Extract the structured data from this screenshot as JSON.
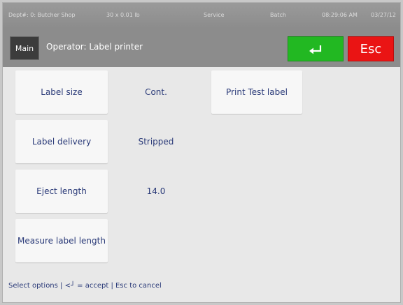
{
  "status": {
    "dept": "Dept#: 0: Butcher Shop",
    "scale": "30 x 0.01 lb",
    "service": "Service",
    "batch": "Batch",
    "time": "08:29:06 AM",
    "date": "03/27/12"
  },
  "header": {
    "main_label": "Main",
    "title": "Operator: Label printer",
    "enter_icon": "enter-arrow-icon",
    "esc_label": "Esc"
  },
  "options": [
    {
      "label": "Label size",
      "value": "Cont."
    },
    {
      "label": "Label delivery",
      "value": "Stripped"
    },
    {
      "label": "Eject length",
      "value": "14.0"
    },
    {
      "label": "Measure label length",
      "value": ""
    }
  ],
  "print_test_label": "Print Test label",
  "footer": {
    "hint": "Select options | <┘ = accept | Esc to cancel"
  },
  "colors": {
    "accept": "#22b822",
    "cancel": "#ea1414",
    "text": "#2a3a78"
  }
}
